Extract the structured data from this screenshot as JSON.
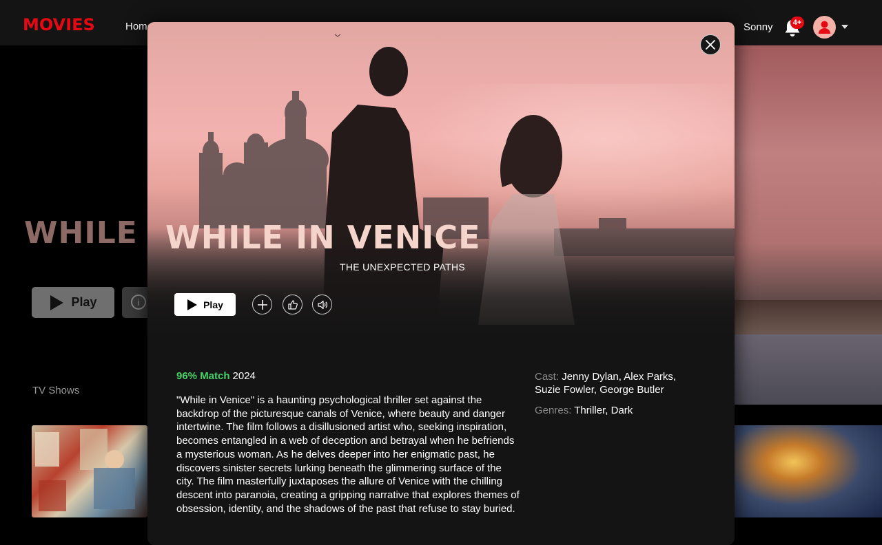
{
  "app": {
    "logo": "MOVIES"
  },
  "nav": {
    "home": "Home",
    "user_name": "Sonny",
    "notifications_badge": "4+"
  },
  "background": {
    "hero_title": "WHILE",
    "play_label": "Play",
    "row_title": "TV Shows"
  },
  "modal": {
    "title": "WHILE IN VENICE",
    "subtitle": "THE UNEXPECTED PATHS",
    "play_label": "Play",
    "match": "96% Match",
    "year": "2024",
    "description": "\"While in Venice\" is a haunting psychological thriller set against the backdrop of the picturesque canals of Venice, where beauty and danger intertwine. The film follows a disillusioned artist who, seeking inspiration, becomes entangled in a web of deception and betrayal when he befriends a mysterious woman. As he delves deeper into her enigmatic past, he discovers sinister secrets lurking beneath the glimmering surface of the city. The film masterfully juxtaposes the allure of Venice with the chilling descent into paranoia, creating a gripping narrative that explores themes of obsession, identity, and the shadows of the past that refuse to stay buried.",
    "cast_label": "Cast:",
    "cast": "Jenny Dylan, Alex Parks, Suzie Fowler, George Butler",
    "genres_label": "Genres:",
    "genres": "Thriller, Dark"
  },
  "icons": {
    "close": "close-icon",
    "play": "play-icon",
    "add": "plus-icon",
    "like": "thumbs-up-icon",
    "volume": "volume-icon",
    "bell": "bell-icon",
    "avatar": "user-icon",
    "caret": "caret-down-icon",
    "info": "info-icon"
  },
  "colors": {
    "brand": "#e50914",
    "match": "#46d369",
    "title": "#f4d4cb"
  }
}
